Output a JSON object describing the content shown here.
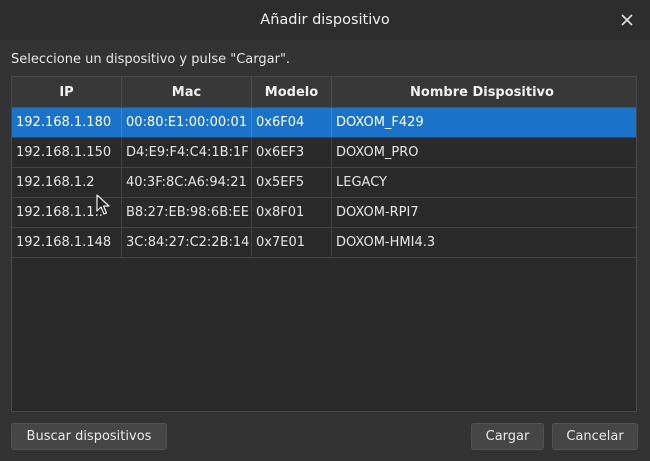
{
  "window": {
    "title": "Añadir dispositivo"
  },
  "instructions": "Seleccione un dispositivo y pulse \"Cargar\".",
  "table": {
    "headers": [
      "IP",
      "Mac",
      "Modelo",
      "Nombre Dispositivo"
    ],
    "rows": [
      [
        "192.168.1.180",
        "00:80:E1:00:00:01",
        "0x6F04",
        "DOXOM_F429"
      ],
      [
        "192.168.1.150",
        "D4:E9:F4:C4:1B:1F",
        "0x6EF3",
        "DOXOM_PRO"
      ],
      [
        "192.168.1.2",
        "40:3F:8C:A6:94:21",
        "0x5EF5",
        "LEGACY"
      ],
      [
        "192.168.1.1..",
        "B8:27:EB:98:6B:EE",
        "0x8F01",
        "DOXOM-RPI7"
      ],
      [
        "192.168.1.148",
        "3C:84:27:C2:2B:14",
        "0x7E01",
        "DOXOM-HMI4.3"
      ]
    ],
    "selected_row": 0
  },
  "buttons": {
    "search": "Buscar dispositivos",
    "load": "Cargar",
    "cancel": "Cancelar"
  },
  "colors": {
    "selection": "#1a73c9",
    "background": "#333333"
  },
  "icons": {
    "close": "close-icon",
    "cursor": "mouse-pointer-icon"
  }
}
